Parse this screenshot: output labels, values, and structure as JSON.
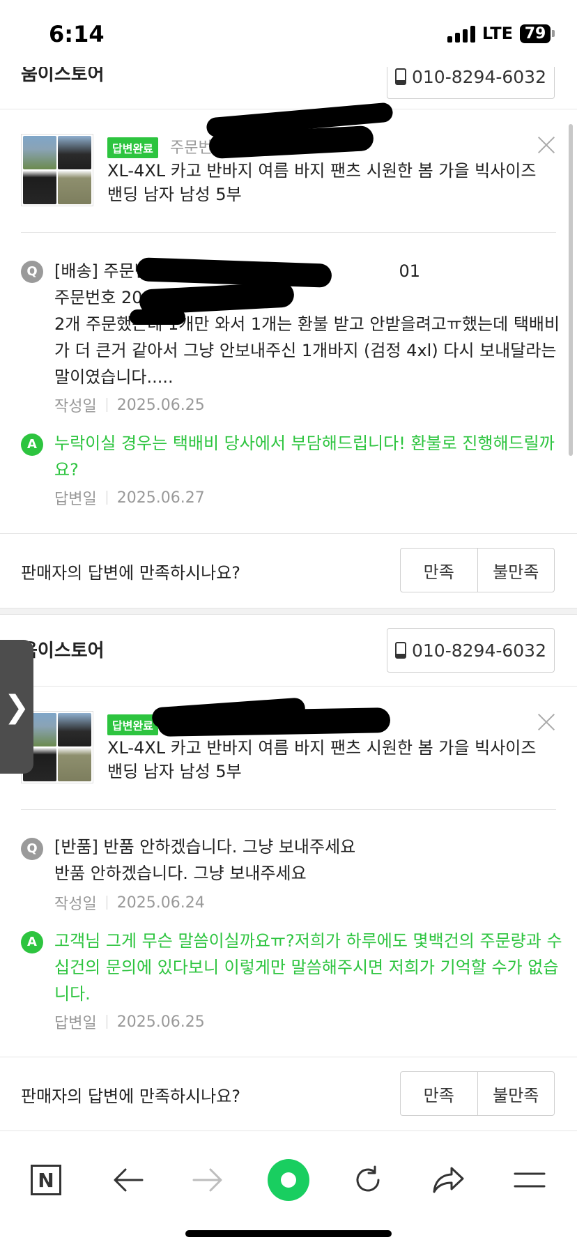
{
  "status_bar": {
    "time": "6:14",
    "network": "LTE",
    "battery": "79"
  },
  "cards": [
    {
      "store_name": "움이스토어",
      "phone": "010-8294-6032",
      "badge": "답변완료",
      "order_label": "주문번호",
      "product_title": "XL-4XL 카고 반바지 여름 바지 팬츠 시원한 봄 가을 빅사이즈 밴딩 남자 남성 5부",
      "question_icon": "Q",
      "question_lines": [
        "[배송] 주문번호 2                                         01",
        "주문번호 20",
        "2개 주문했는데 1개만 와서 1개는 환불 받고 안받을려고ㅠ했는데 택배비",
        "가 더 큰거 같아서 그냥 안보내주신 1개바지 (검정 4xl) 다시 보내달라는",
        "말이였습니다....."
      ],
      "question_date_label": "작성일",
      "question_date": "2025.06.25",
      "answer_icon": "A",
      "answer_lines": [
        "누락이실 경우는 택배비 당사에서 부담해드립니다! 환불로 진행해드릴까",
        "요?"
      ],
      "answer_date_label": "답변일",
      "answer_date": "2025.06.27",
      "feedback_question": "판매자의 답변에 만족하시나요?",
      "satisfied": "만족",
      "unsatisfied": "불만족"
    },
    {
      "store_name": "움이스토어",
      "phone": "010-8294-6032",
      "badge": "답변완료",
      "order_label": "",
      "product_title": "XL-4XL 카고 반바지 여름 바지 팬츠 시원한 봄 가을 빅사이즈 밴딩 남자 남성 5부",
      "question_icon": "Q",
      "question_lines": [
        "[반품] 반품 안하겠습니다. 그냥 보내주세요",
        "반품 안하겠습니다. 그냥 보내주세요"
      ],
      "question_date_label": "작성일",
      "question_date": "2025.06.24",
      "answer_icon": "A",
      "answer_lines": [
        "고객님 그게 무슨 말씀이실까요ㅠ?저희가 하루에도 몇백건의 주문량과 수",
        "십건의 문의에 있다보니 이렇게만 말씀해주시면 저희가 기억할 수가 없습",
        "니다."
      ],
      "answer_date_label": "답변일",
      "answer_date": "2025.06.25",
      "feedback_question": "판매자의 답변에 만족하시나요?",
      "satisfied": "만족",
      "unsatisfied": "불만족"
    }
  ],
  "side_handle": "❯",
  "toolbar": {
    "icons": [
      "naver-n-icon",
      "back-arrow-icon",
      "forward-arrow-icon",
      "green-home-icon",
      "refresh-icon",
      "share-icon",
      "menu-icon"
    ],
    "n_label": "N"
  }
}
